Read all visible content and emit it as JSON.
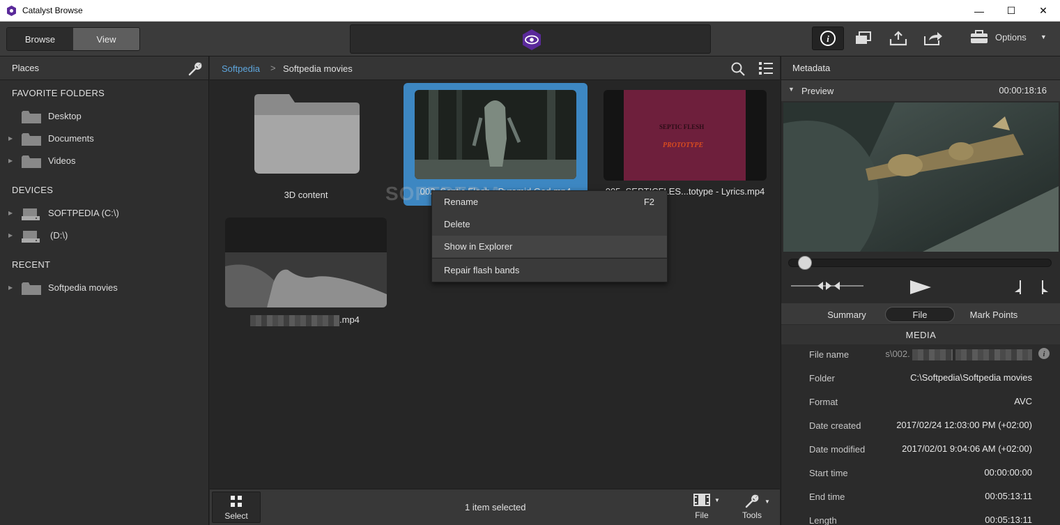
{
  "window": {
    "title": "Catalyst Browse",
    "minimize": "—",
    "maximize": "☐",
    "close": "✕"
  },
  "toolbar": {
    "browse_label": "Browse",
    "view_label": "View",
    "options_label": "Options",
    "accent": "#5a2a9a"
  },
  "left_panel": {
    "title": "Places",
    "favorites_title": "FAVORITE FOLDERS",
    "favorites": [
      "Desktop",
      "Documents",
      "Videos"
    ],
    "devices_title": "DEVICES",
    "devices": [
      "SOFTPEDIA (C:\\)",
      "(D:\\)"
    ],
    "recent_title": "RECENT",
    "recent": [
      "Softpedia movies"
    ]
  },
  "breadcrumb": {
    "root": "Softpedia",
    "sep": ">",
    "current": "Softpedia movies"
  },
  "items": {
    "folder_label": "3D content",
    "clip1_label": "002_Septic Flesh - Pyramid God.mp4",
    "clip2_label": "005_SEPTICFLES...totype - Lyrics.mp4",
    "clip2_text1": "SEPTIC FLESH",
    "clip2_text2": "PROTOTYPE",
    "clip3_label": ".mp4",
    "watermark": "SOFTPEDIA"
  },
  "context_menu": {
    "rename": "Rename",
    "rename_shortcut": "F2",
    "delete": "Delete",
    "show_explorer": "Show in Explorer",
    "repair": "Repair flash bands"
  },
  "bottom_bar": {
    "select_label": "Select",
    "status": "1 item selected",
    "file_label": "File",
    "tools_label": "Tools"
  },
  "right_panel": {
    "title": "Metadata",
    "preview_label": "Preview",
    "timecode": "00:00:18:16",
    "tabs": [
      "Summary",
      "File",
      "Mark Points"
    ],
    "media_title": "MEDIA",
    "rows": [
      {
        "key": "File name",
        "value": "s\\002."
      },
      {
        "key": "Folder",
        "value": "C:\\Softpedia\\Softpedia movies"
      },
      {
        "key": "Format",
        "value": "AVC"
      },
      {
        "key": "Date created",
        "value": "2017/02/24 12:03:00 PM (+02:00)"
      },
      {
        "key": "Date modified",
        "value": "2017/02/01 9:04:06 AM (+02:00)"
      },
      {
        "key": "Start time",
        "value": "00:00:00:00"
      },
      {
        "key": "End time",
        "value": "00:05:13:11"
      },
      {
        "key": "Length",
        "value": "00:05:13:11"
      }
    ]
  }
}
